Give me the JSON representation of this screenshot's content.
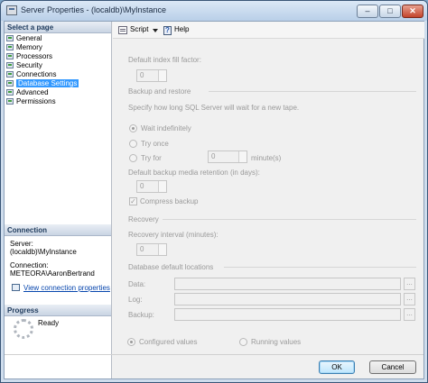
{
  "window": {
    "title": "Server Properties - (localdb)\\MyInstance",
    "controls": [
      "minimize",
      "maximize",
      "close"
    ]
  },
  "left": {
    "select_page_header": "Select a page",
    "pages": [
      {
        "label": "General",
        "selected": false
      },
      {
        "label": "Memory",
        "selected": false
      },
      {
        "label": "Processors",
        "selected": false
      },
      {
        "label": "Security",
        "selected": false
      },
      {
        "label": "Connections",
        "selected": false
      },
      {
        "label": "Database Settings",
        "selected": true
      },
      {
        "label": "Advanced",
        "selected": false
      },
      {
        "label": "Permissions",
        "selected": false
      }
    ],
    "connection_header": "Connection",
    "server_label": "Server:",
    "server_value": "(localdb)\\MyInstance",
    "connection_label": "Connection:",
    "connection_value": "METEORA\\AaronBertrand",
    "view_connection_link": "View connection properties",
    "progress_header": "Progress",
    "progress_status": "Ready"
  },
  "toolbar": {
    "script_label": "Script",
    "help_label": "Help"
  },
  "form": {
    "fill_factor_label": "Default index fill factor:",
    "fill_factor_value": "0",
    "backup_restore_header": "Backup and restore",
    "backup_wait_prompt": "Specify how long SQL Server will wait for a new tape.",
    "wait_indefinitely": "Wait indefinitely",
    "try_once": "Try once",
    "try_for": "Try for",
    "try_for_value": "0",
    "minutes_label": "minute(s)",
    "retention_label": "Default backup media retention (in days):",
    "retention_value": "0",
    "compress_backup": "Compress backup",
    "recovery_header": "Recovery",
    "recovery_interval_label": "Recovery interval (minutes):",
    "recovery_interval_value": "0",
    "db_locations_header": "Database default locations",
    "data_label": "Data:",
    "log_label": "Log:",
    "backup_label": "Backup:",
    "browse_label": "...",
    "configured_values": "Configured values",
    "running_values": "Running values"
  },
  "buttons": {
    "ok": "OK",
    "cancel": "Cancel"
  }
}
